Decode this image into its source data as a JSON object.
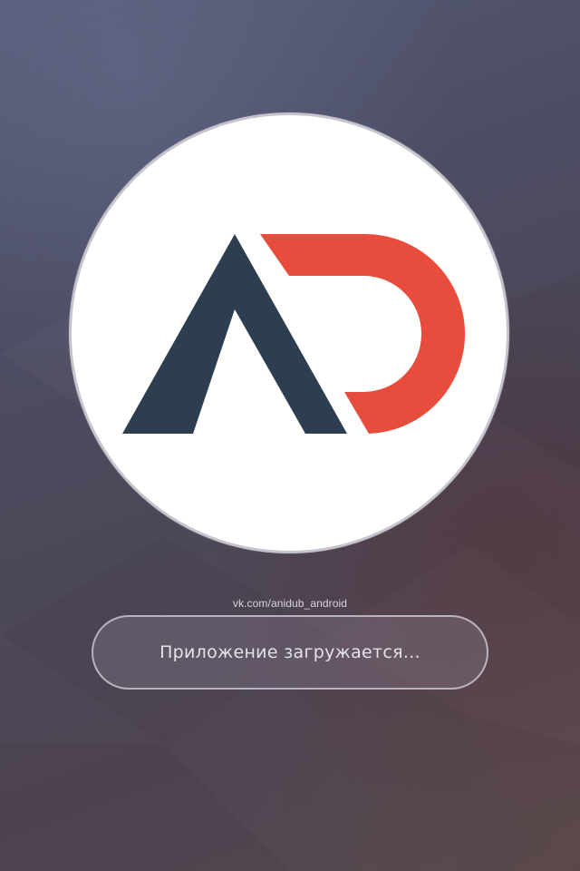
{
  "screen": {
    "type": "splash",
    "colors": {
      "logo_dark": "#2c3e50",
      "logo_red": "#e74c3c",
      "circle_bg": "#ffffff"
    }
  },
  "logo": {
    "icon": "anidub-ad-logo"
  },
  "link": {
    "text": "vk.com/anidub_android"
  },
  "status": {
    "text": "Приложение загружается..."
  }
}
